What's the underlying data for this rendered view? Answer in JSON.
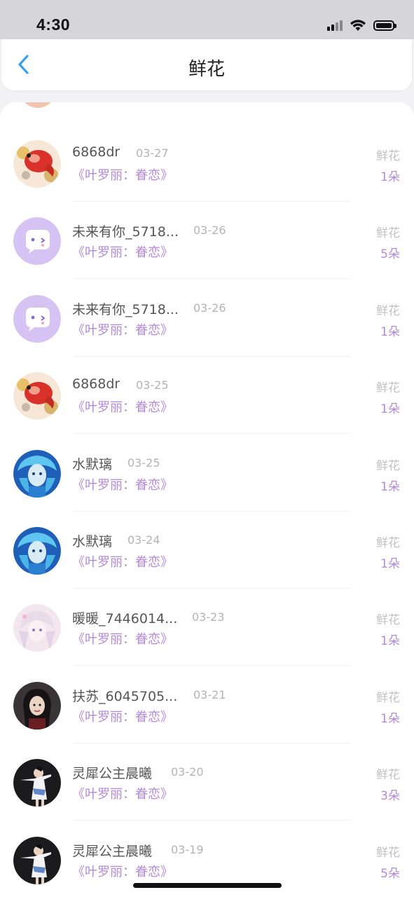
{
  "status_bar": {
    "time": "4:30"
  },
  "header": {
    "title": "鲜花"
  },
  "items": [
    {
      "user": "6868dr",
      "date": "03-27",
      "book": "《叶罗丽：眷恋》",
      "gift": "鲜花",
      "count": "1朵",
      "avatar": "koi-fish-avatar"
    },
    {
      "user": "未来有你_5718...",
      "date": "03-26",
      "book": "《叶罗丽：眷恋》",
      "gift": "鲜花",
      "count": "5朵",
      "avatar": "chat-bubble-avatar"
    },
    {
      "user": "未来有你_5718...",
      "date": "03-26",
      "book": "《叶罗丽：眷恋》",
      "gift": "鲜花",
      "count": "1朵",
      "avatar": "chat-bubble-avatar"
    },
    {
      "user": "6868dr",
      "date": "03-25",
      "book": "《叶罗丽：眷恋》",
      "gift": "鲜花",
      "count": "1朵",
      "avatar": "koi-fish-avatar"
    },
    {
      "user": "水默璃",
      "date": "03-25",
      "book": "《叶罗丽：眷恋》",
      "gift": "鲜花",
      "count": "1朵",
      "avatar": "blue-doll-avatar"
    },
    {
      "user": "水默璃",
      "date": "03-24",
      "book": "《叶罗丽：眷恋》",
      "gift": "鲜花",
      "count": "1朵",
      "avatar": "blue-doll-avatar"
    },
    {
      "user": "暖暖_7446014...",
      "date": "03-23",
      "book": "《叶罗丽：眷恋》",
      "gift": "鲜花",
      "count": "1朵",
      "avatar": "pink-anime-avatar"
    },
    {
      "user": "扶苏_6045705...",
      "date": "03-21",
      "book": "《叶罗丽：眷恋》",
      "gift": "鲜花",
      "count": "1朵",
      "avatar": "dark-portrait-avatar"
    },
    {
      "user": "灵犀公主晨曦",
      "date": "03-20",
      "book": "《叶罗丽：眷恋》",
      "gift": "鲜花",
      "count": "3朵",
      "avatar": "dancer-avatar"
    },
    {
      "user": "灵犀公主晨曦",
      "date": "03-19",
      "book": "《叶罗丽：眷恋》",
      "gift": "鲜花",
      "count": "5朵",
      "avatar": "dancer-avatar"
    }
  ],
  "colors": {
    "accent": "#b389d8",
    "muted": "#b3b3b8",
    "back": "#3a9ff0"
  }
}
